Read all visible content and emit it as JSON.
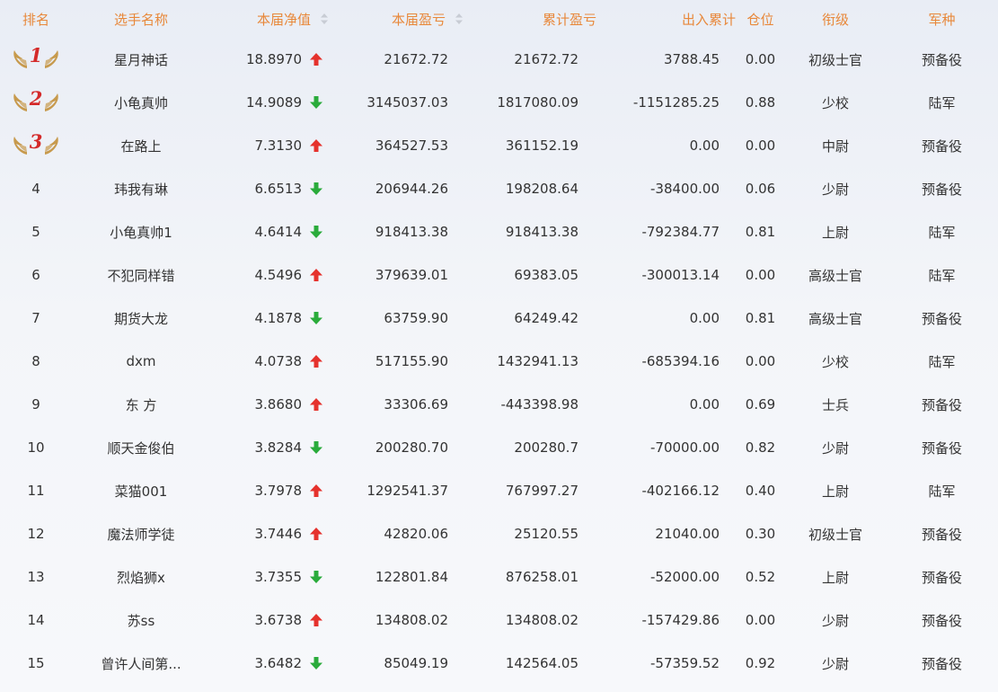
{
  "colors": {
    "header_text": "#e8883a",
    "up_arrow": "#e5322d",
    "down_arrow": "#2aab3b",
    "medal_number": "#d42a2a",
    "wing": "#c79a4d"
  },
  "icons": {
    "up": "arrow-up-icon",
    "down": "arrow-down-icon",
    "sort": "sort-icon",
    "medal": "wing-medal-icon"
  },
  "header": {
    "rank": "排名",
    "name": "选手名称",
    "nav": "本届净值",
    "pnl": "本届盈亏",
    "cum": "累计盈亏",
    "flow": "出入累计",
    "pos": "仓位",
    "grade": "衔级",
    "army": "军种"
  },
  "rows": [
    {
      "rank": "1",
      "medal": true,
      "name": "星月神话",
      "nav": "18.8970",
      "trend": "up",
      "pnl": "21672.72",
      "cum": "21672.72",
      "flow": "3788.45",
      "pos": "0.00",
      "grade": "初级士官",
      "army": "预备役"
    },
    {
      "rank": "2",
      "medal": true,
      "name": "小龟真帅",
      "nav": "14.9089",
      "trend": "down",
      "pnl": "3145037.03",
      "cum": "1817080.09",
      "flow": "-1151285.25",
      "pos": "0.88",
      "grade": "少校",
      "army": "陆军"
    },
    {
      "rank": "3",
      "medal": true,
      "name": "在路上",
      "nav": "7.3130",
      "trend": "up",
      "pnl": "364527.53",
      "cum": "361152.19",
      "flow": "0.00",
      "pos": "0.00",
      "grade": "中尉",
      "army": "预备役"
    },
    {
      "rank": "4",
      "medal": false,
      "name": "玮我有琳",
      "nav": "6.6513",
      "trend": "down",
      "pnl": "206944.26",
      "cum": "198208.64",
      "flow": "-38400.00",
      "pos": "0.06",
      "grade": "少尉",
      "army": "预备役"
    },
    {
      "rank": "5",
      "medal": false,
      "name": "小龟真帅1",
      "nav": "4.6414",
      "trend": "down",
      "pnl": "918413.38",
      "cum": "918413.38",
      "flow": "-792384.77",
      "pos": "0.81",
      "grade": "上尉",
      "army": "陆军"
    },
    {
      "rank": "6",
      "medal": false,
      "name": "不犯同样错",
      "nav": "4.5496",
      "trend": "up",
      "pnl": "379639.01",
      "cum": "69383.05",
      "flow": "-300013.14",
      "pos": "0.00",
      "grade": "高级士官",
      "army": "陆军"
    },
    {
      "rank": "7",
      "medal": false,
      "name": "期货大龙",
      "nav": "4.1878",
      "trend": "down",
      "pnl": "63759.90",
      "cum": "64249.42",
      "flow": "0.00",
      "pos": "0.81",
      "grade": "高级士官",
      "army": "预备役"
    },
    {
      "rank": "8",
      "medal": false,
      "name": "dxm",
      "nav": "4.0738",
      "trend": "up",
      "pnl": "517155.90",
      "cum": "1432941.13",
      "flow": "-685394.16",
      "pos": "0.00",
      "grade": "少校",
      "army": "陆军"
    },
    {
      "rank": "9",
      "medal": false,
      "name": "东 方",
      "nav": "3.8680",
      "trend": "up",
      "pnl": "33306.69",
      "cum": "-443398.98",
      "flow": "0.00",
      "pos": "0.69",
      "grade": "士兵",
      "army": "预备役"
    },
    {
      "rank": "10",
      "medal": false,
      "name": "顺天金俊伯",
      "nav": "3.8284",
      "trend": "down",
      "pnl": "200280.70",
      "cum": "200280.7",
      "flow": "-70000.00",
      "pos": "0.82",
      "grade": "少尉",
      "army": "预备役"
    },
    {
      "rank": "11",
      "medal": false,
      "name": "菜猫001",
      "nav": "3.7978",
      "trend": "up",
      "pnl": "1292541.37",
      "cum": "767997.27",
      "flow": "-402166.12",
      "pos": "0.40",
      "grade": "上尉",
      "army": "陆军"
    },
    {
      "rank": "12",
      "medal": false,
      "name": "魔法师学徒",
      "nav": "3.7446",
      "trend": "up",
      "pnl": "42820.06",
      "cum": "25120.55",
      "flow": "21040.00",
      "pos": "0.30",
      "grade": "初级士官",
      "army": "预备役"
    },
    {
      "rank": "13",
      "medal": false,
      "name": "烈焰狮x",
      "nav": "3.7355",
      "trend": "down",
      "pnl": "122801.84",
      "cum": "876258.01",
      "flow": "-52000.00",
      "pos": "0.52",
      "grade": "上尉",
      "army": "预备役"
    },
    {
      "rank": "14",
      "medal": false,
      "name": "苏ss",
      "nav": "3.6738",
      "trend": "up",
      "pnl": "134808.02",
      "cum": "134808.02",
      "flow": "-157429.86",
      "pos": "0.00",
      "grade": "少尉",
      "army": "预备役"
    },
    {
      "rank": "15",
      "medal": false,
      "name": "曾许人间第...",
      "nav": "3.6482",
      "trend": "down",
      "pnl": "85049.19",
      "cum": "142564.05",
      "flow": "-57359.52",
      "pos": "0.92",
      "grade": "少尉",
      "army": "预备役"
    }
  ]
}
